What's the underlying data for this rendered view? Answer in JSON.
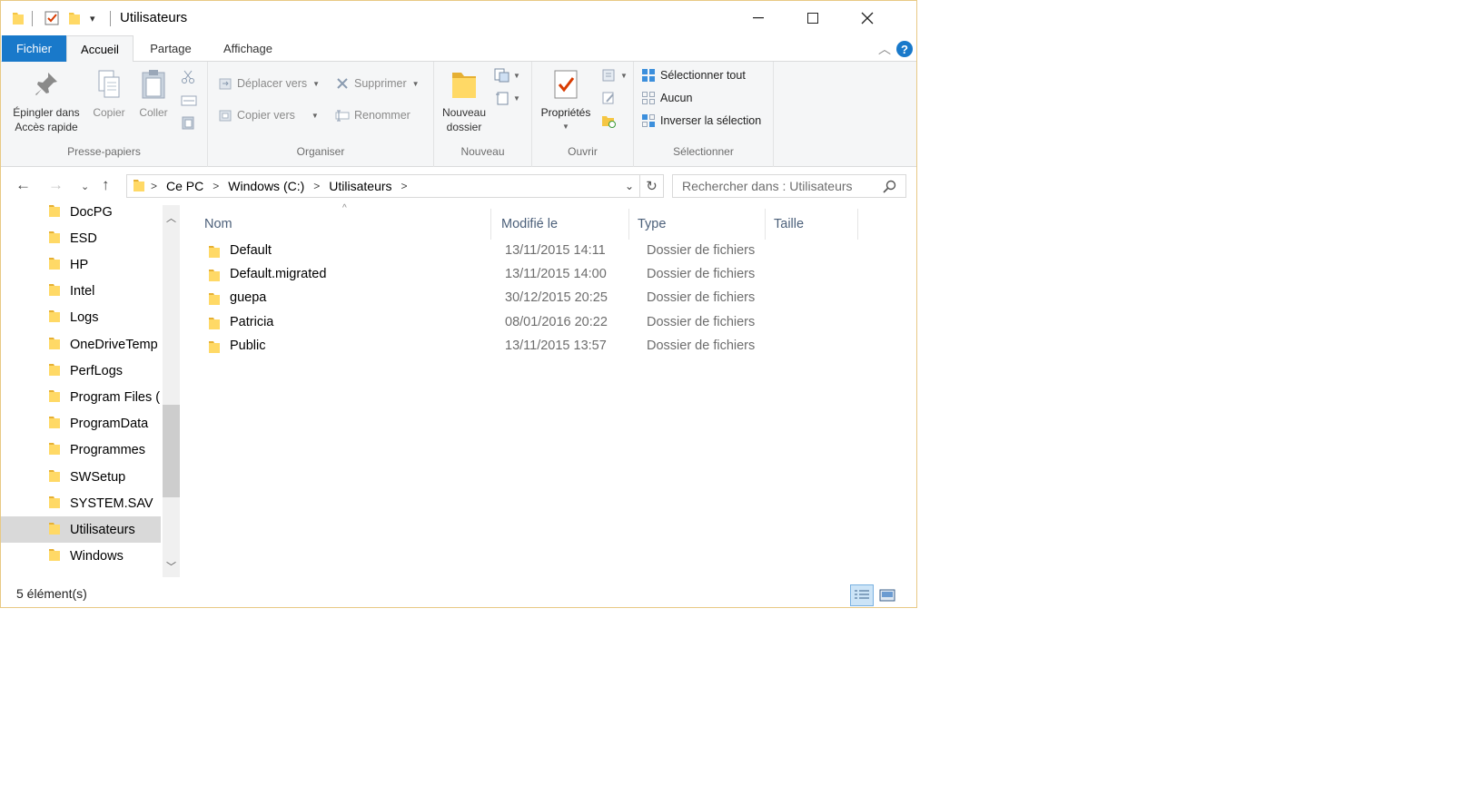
{
  "window": {
    "title": "Utilisateurs"
  },
  "tabs": [
    {
      "label": "Fichier"
    },
    {
      "label": "Accueil"
    },
    {
      "label": "Partage"
    },
    {
      "label": "Affichage"
    }
  ],
  "ribbon": {
    "clipboard": {
      "label": "Presse-papiers",
      "pin_line1": "Épingler dans",
      "pin_line2": "Accès rapide",
      "copy": "Copier",
      "paste": "Coller"
    },
    "organize": {
      "label": "Organiser",
      "move_to": "Déplacer vers",
      "copy_to": "Copier vers",
      "delete": "Supprimer",
      "rename": "Renommer"
    },
    "new": {
      "label": "Nouveau",
      "new_folder_line1": "Nouveau",
      "new_folder_line2": "dossier"
    },
    "open": {
      "label": "Ouvrir",
      "properties": "Propriétés"
    },
    "select": {
      "label": "Sélectionner",
      "select_all": "Sélectionner tout",
      "none": "Aucun",
      "invert": "Inverser la sélection"
    }
  },
  "address": {
    "crumbs": [
      "Ce PC",
      "Windows (C:)",
      "Utilisateurs"
    ],
    "search_placeholder": "Rechercher dans : Utilisateurs"
  },
  "nav_items": [
    "DocPG",
    "ESD",
    "HP",
    "Intel",
    "Logs",
    "OneDriveTemp",
    "PerfLogs",
    "Program Files (",
    "ProgramData",
    "Programmes",
    "SWSetup",
    "SYSTEM.SAV",
    "Utilisateurs",
    "Windows"
  ],
  "selected_nav": "Utilisateurs",
  "columns": {
    "name": "Nom",
    "modified": "Modifié le",
    "type": "Type",
    "size": "Taille"
  },
  "files": [
    {
      "name": "Default",
      "modified": "13/11/2015 14:11",
      "type": "Dossier de fichiers"
    },
    {
      "name": "Default.migrated",
      "modified": "13/11/2015 14:00",
      "type": "Dossier de fichiers"
    },
    {
      "name": "guepa",
      "modified": "30/12/2015 20:25",
      "type": "Dossier de fichiers"
    },
    {
      "name": "Patricia",
      "modified": "08/01/2016 20:22",
      "type": "Dossier de fichiers"
    },
    {
      "name": "Public",
      "modified": "13/11/2015 13:57",
      "type": "Dossier de fichiers"
    }
  ],
  "status": {
    "count": "5 élément(s)"
  },
  "colors": {
    "accent": "#1979ca",
    "folder": "#f5c643"
  }
}
